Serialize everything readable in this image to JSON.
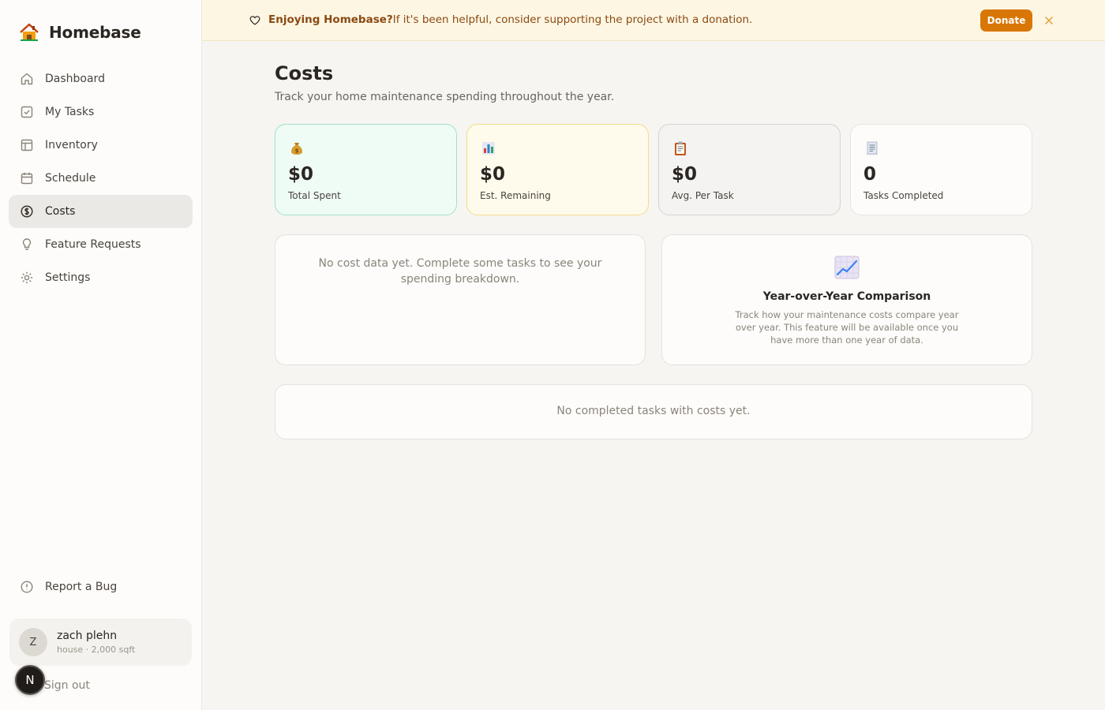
{
  "app": {
    "name": "Homebase"
  },
  "sidebar": {
    "items": [
      {
        "label": "Dashboard",
        "icon": "home-icon"
      },
      {
        "label": "My Tasks",
        "icon": "checkbox-icon"
      },
      {
        "label": "Inventory",
        "icon": "layout-icon"
      },
      {
        "label": "Schedule",
        "icon": "calendar-icon"
      },
      {
        "label": "Costs",
        "icon": "dollar-circle-icon",
        "active": true
      },
      {
        "label": "Feature Requests",
        "icon": "lightbulb-icon"
      },
      {
        "label": "Settings",
        "icon": "gear-icon"
      }
    ],
    "report_bug": "Report a Bug",
    "user": {
      "initial": "Z",
      "name": "zach plehn",
      "meta": "house · 2,000 sqft"
    },
    "sign_out": "Sign out",
    "dev_badge": "N"
  },
  "banner": {
    "bold": "Enjoying Homebase?",
    "text": "If it's been helpful, consider supporting the project with a donation.",
    "donate_label": "Donate",
    "accent": "#d97706"
  },
  "page": {
    "title": "Costs",
    "subtitle": "Track your home maintenance spending throughout the year."
  },
  "stats": [
    {
      "icon": "money-bag-icon",
      "value": "$0",
      "label": "Total Spent"
    },
    {
      "icon": "bar-chart-icon",
      "value": "$0",
      "label": "Est. Remaining"
    },
    {
      "icon": "clipboard-icon",
      "value": "$0",
      "label": "Avg. Per Task"
    },
    {
      "icon": "receipt-icon",
      "value": "0",
      "label": "Tasks Completed"
    }
  ],
  "breakdown": {
    "empty": "No cost data yet. Complete some tasks to see your spending breakdown."
  },
  "yoy": {
    "title": "Year-over-Year Comparison",
    "description": "Track how your maintenance costs compare year over year. This feature will be available once you have more than one year of data."
  },
  "completed": {
    "empty": "No completed tasks with costs yet."
  }
}
